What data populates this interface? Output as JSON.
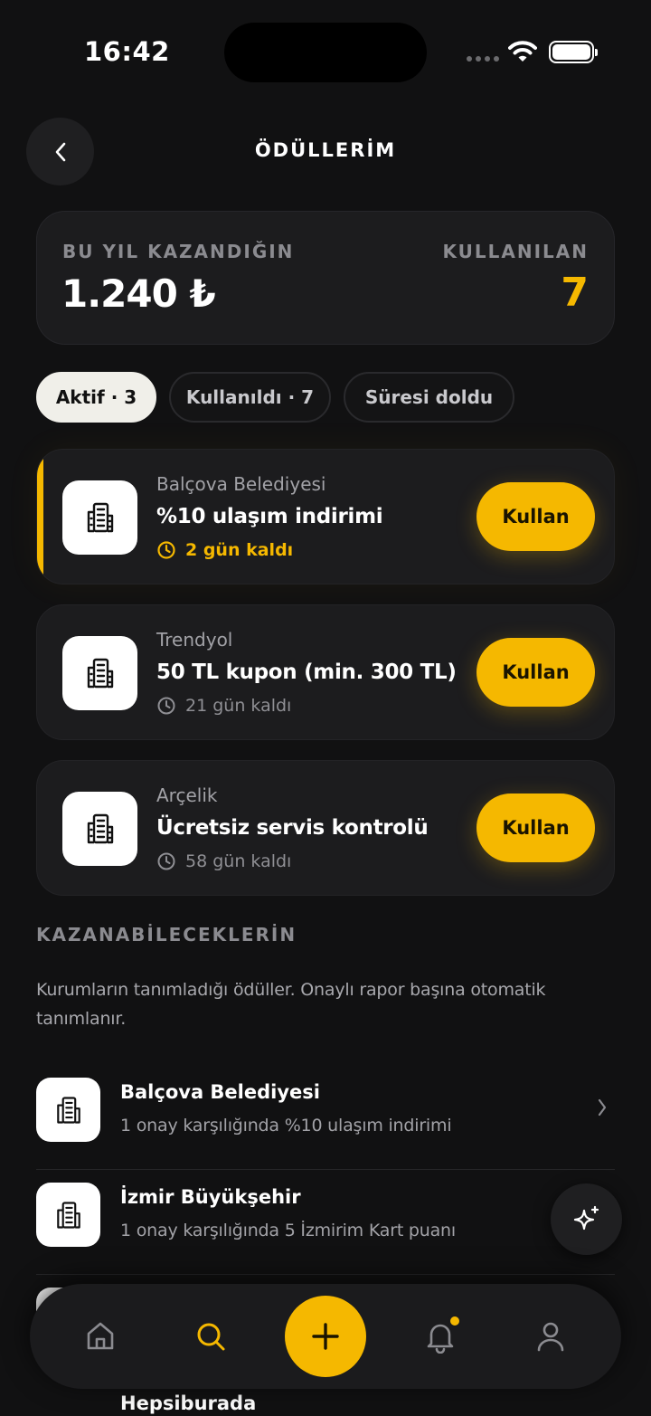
{
  "status_bar": {
    "time": "16:42"
  },
  "header": {
    "title": "ÖDÜLLERİM"
  },
  "stats": {
    "earned_label": "BU YIL KAZANDIĞIN",
    "earned_value": "1.240 ₺",
    "used_label": "KULLANILAN",
    "used_value": "7"
  },
  "tabs": [
    {
      "label": "Aktif · 3",
      "active": true
    },
    {
      "label": "Kullanıldı · 7",
      "active": false
    },
    {
      "label": "Süresi doldu",
      "active": false
    }
  ],
  "rewards": [
    {
      "org": "Balçova Belediyesi",
      "title": "%10 ulaşım indirimi",
      "remaining": "2 gün kaldı",
      "button": "Kullan"
    },
    {
      "org": "Trendyol",
      "title": "50 TL kupon (min. 300 TL)",
      "remaining": "21 gün kaldı",
      "button": "Kullan"
    },
    {
      "org": "Arçelik",
      "title": "Ücretsiz servis kontrolü",
      "remaining": "58 gün kaldı",
      "button": "Kullan"
    }
  ],
  "earnable": {
    "title": "KAZANABİLECEKLERİN",
    "description": "Kurumların tanımladığı ödüller. Onaylı rapor başına otomatik tanımlanır.",
    "items": [
      {
        "name": "Balçova Belediyesi",
        "desc": "1 onay karşılığında %10 ulaşım indirimi"
      },
      {
        "name": "İzmir Büyükşehir",
        "desc": "1 onay karşılığında 5 İzmirim Kart puanı"
      },
      {
        "name": "Hepsiburada",
        "desc": ""
      }
    ]
  },
  "colors": {
    "accent": "#f5b800",
    "background": "#111112",
    "card": "#1c1c1e"
  },
  "icons": {
    "back": "chevron-left-icon",
    "org_logo": "building-icon",
    "clock": "clock-icon",
    "chevron": "chevron-right-icon",
    "sparkle": "sparkle-icon",
    "nav": [
      "home-icon",
      "search-icon",
      "plus-icon",
      "bell-icon",
      "user-icon"
    ]
  }
}
